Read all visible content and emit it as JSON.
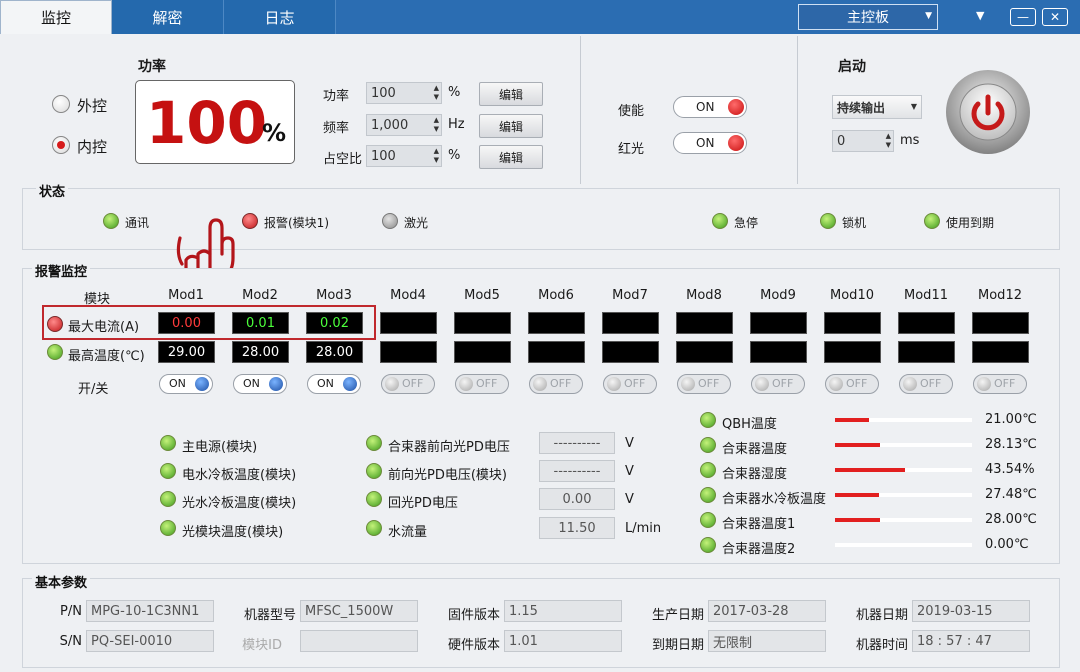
{
  "tabs": [
    {
      "label": "监控"
    },
    {
      "label": "解密"
    },
    {
      "label": "日志"
    }
  ],
  "board_select": {
    "value": "主控板"
  },
  "window": {
    "dropdown_glyph": "▼",
    "minimize_glyph": "—",
    "close_glyph": "✕"
  },
  "power": {
    "title": "功率",
    "control_options": [
      {
        "label": "外控",
        "selected": false
      },
      {
        "label": "内控",
        "selected": true
      }
    ],
    "display_value": "100",
    "display_unit": "%",
    "fields": [
      {
        "label": "功率",
        "value": "100",
        "unit": "%",
        "button": "编辑"
      },
      {
        "label": "频率",
        "value": "1,000",
        "unit": "Hz",
        "button": "编辑"
      },
      {
        "label": "占空比",
        "value": "100",
        "unit": "%",
        "button": "编辑"
      }
    ]
  },
  "enable": {
    "items": [
      {
        "label": "使能",
        "state": "ON"
      },
      {
        "label": "红光",
        "state": "ON"
      }
    ]
  },
  "start": {
    "title": "启动",
    "mode": "持续输出",
    "delay_value": "0",
    "delay_unit": "ms",
    "power_icon": "power-icon"
  },
  "status": {
    "title": "状态",
    "indicators": [
      {
        "label": "通讯",
        "color": "green"
      },
      {
        "label": "报警(模块1)",
        "color": "red"
      },
      {
        "label": "激光",
        "color": "gray"
      },
      {
        "label": "急停",
        "color": "green"
      },
      {
        "label": "锁机",
        "color": "green"
      },
      {
        "label": "使用到期",
        "color": "green"
      }
    ]
  },
  "alarm": {
    "title": "报警监控",
    "module_header": "模块",
    "modules": [
      "Mod1",
      "Mod2",
      "Mod3",
      "Mod4",
      "Mod5",
      "Mod6",
      "Mod7",
      "Mod8",
      "Mod9",
      "Mod10",
      "Mod11",
      "Mod12"
    ],
    "max_current": {
      "label": "最大电流(A)",
      "values": [
        "0.00",
        "0.01",
        "0.02",
        "",
        "",
        "",
        "",
        "",
        "",
        "",
        "",
        ""
      ],
      "colors": [
        "#ff3b3b",
        "#4cff3b",
        "#4cff3b"
      ]
    },
    "max_temp": {
      "label": "最高温度(℃)",
      "values": [
        "29.00",
        "28.00",
        "28.00",
        "",
        "",
        "",
        "",
        "",
        "",
        "",
        "",
        ""
      ]
    },
    "switch": {
      "label": "开/关",
      "states": [
        "ON",
        "ON",
        "ON",
        "OFF",
        "OFF",
        "OFF",
        "OFF",
        "OFF",
        "OFF",
        "OFF",
        "OFF",
        "OFF"
      ]
    },
    "left_checks": [
      "主电源(模块)",
      "电水冷板温度(模块)",
      "光水冷板温度(模块)",
      "光模块温度(模块)"
    ],
    "mid_checks": [
      {
        "label": "合束器前向光PD电压",
        "value": "----------",
        "unit": "V"
      },
      {
        "label": "前向光PD电压(模块)",
        "value": "----------",
        "unit": "V"
      },
      {
        "label": "回光PD电压",
        "value": "0.00",
        "unit": "V"
      },
      {
        "label": "水流量",
        "value": "11.50",
        "unit": "L/min"
      }
    ],
    "gauges": [
      {
        "label": "QBH温度",
        "value": "21.00℃",
        "fill": 0.25
      },
      {
        "label": "合束器温度",
        "value": "28.13℃",
        "fill": 0.33
      },
      {
        "label": "合束器湿度",
        "value": "43.54%",
        "fill": 0.51
      },
      {
        "label": "合束器水冷板温度",
        "value": "27.48℃",
        "fill": 0.32
      },
      {
        "label": "合束器温度1",
        "value": "28.00℃",
        "fill": 0.33
      },
      {
        "label": "合束器温度2",
        "value": "0.00℃",
        "fill": 0
      }
    ]
  },
  "basic": {
    "title": "基本参数",
    "pn": {
      "label": "P/N",
      "value": "MPG-10-1C3NN1"
    },
    "sn": {
      "label": "S/N",
      "value": "PQ-SEI-0010"
    },
    "model": {
      "label": "机器型号",
      "value": "MFSC_1500W"
    },
    "module_id": {
      "label": "模块ID",
      "value": ""
    },
    "firmware": {
      "label": "固件版本",
      "value": "1.15"
    },
    "hardware": {
      "label": "硬件版本",
      "value": "1.01"
    },
    "prod_date": {
      "label": "生产日期",
      "value": "2017-03-28"
    },
    "expire_date": {
      "label": "到期日期",
      "value": "无限制"
    },
    "machine_date": {
      "label": "机器日期",
      "value": "2019-03-15"
    },
    "machine_time": {
      "label": "机器时间",
      "value": "18 : 57 : 47"
    }
  }
}
